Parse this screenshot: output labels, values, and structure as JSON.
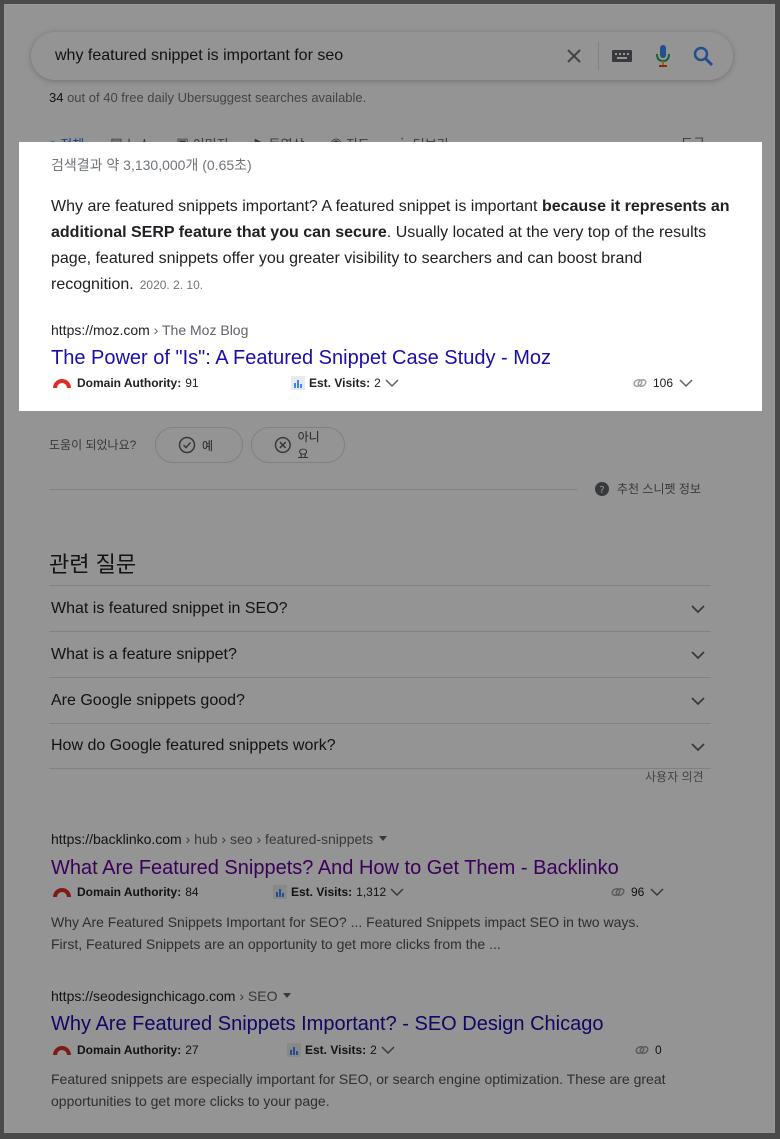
{
  "search": {
    "query": "why featured snippet is important for seo",
    "quota_used": "34",
    "quota_rest": " out of 40 free daily Ubersuggest searches available."
  },
  "tabs": [
    {
      "label": "전체",
      "icon": "search-icon"
    },
    {
      "label": "뉴스",
      "icon": "news-icon"
    },
    {
      "label": "이미지",
      "icon": "image-icon"
    },
    {
      "label": "동영상",
      "icon": "video-icon"
    },
    {
      "label": "지도",
      "icon": "map-icon"
    },
    {
      "label": "더보기",
      "icon": "more-icon"
    }
  ],
  "tools_label": "도구",
  "featured": {
    "stats": "검색결과 약 3,130,000개 (0.65초)",
    "text_pre": "Why are featured snippets important? A featured snippet is important ",
    "text_bold": "because it represents an additional SERP feature that you can secure",
    "text_post": ". Usually located at the very top of the results page, featured snippets offer you greater visibility to searchers and can boost brand recognition.",
    "date": "2020. 2. 10.",
    "url_domain": "https://moz.com",
    "url_crumb": " › The Moz Blog",
    "title": "The Power of \"Is\": A Featured Snippet Case Study - Moz",
    "metrics": {
      "da_label": "Domain Authority:",
      "da": "91",
      "ev_label": "Est. Visits:",
      "ev": "2",
      "links": "106"
    }
  },
  "helpful": {
    "label": "도움이 되었나요?",
    "yes": "예",
    "no": "아니요",
    "info": "추천 스니펫 정보"
  },
  "related": {
    "title": "관련 질문",
    "items": [
      "What is featured snippet in SEO?",
      "What is a feature snippet?",
      "Are Google snippets good?",
      "How do Google featured snippets work?"
    ],
    "feedback": "사용자 의견"
  },
  "results": [
    {
      "url_domain": "https://backlinko.com",
      "url_crumb": " › hub › seo › featured-snippets",
      "title": "What Are Featured Snippets? And How to Get Them - Backlinko",
      "metrics": {
        "da_label": "Domain Authority:",
        "da": "84",
        "ev_label": "Est. Visits:",
        "ev": "1,312",
        "links": "96"
      },
      "snippet": "Why Are Featured Snippets Important for SEO? ... Featured Snippets impact SEO in two ways. First, Featured Snippets are an opportunity to get more clicks from the ..."
    },
    {
      "url_domain": "https://seodesignchicago.com",
      "url_crumb": " › SEO",
      "title": "Why Are Featured Snippets Important? - SEO Design Chicago",
      "metrics": {
        "da_label": "Domain Authority:",
        "da": "27",
        "ev_label": "Est. Visits:",
        "ev": "2",
        "links": "0"
      },
      "snippet": "Featured snippets are especially important for SEO, or search engine optimization. These are great opportunities to get more clicks to your page."
    }
  ],
  "colors": {
    "link": "#1a0dab",
    "visited": "#660099",
    "accent": "#1a73e8"
  }
}
